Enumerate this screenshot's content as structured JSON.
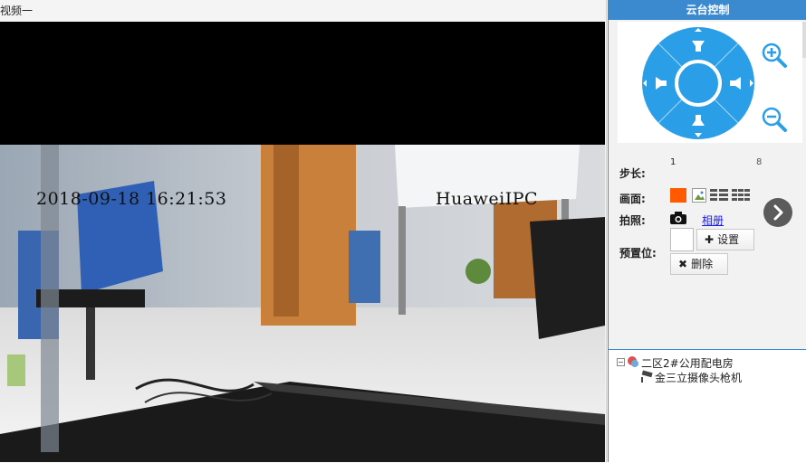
{
  "video": {
    "title": "视频一",
    "osd_time": "2018-09-18 16:21:53",
    "osd_brand": "HuaweiIPC"
  },
  "ptz": {
    "header": "云台控制",
    "step_label": "步长:",
    "step_min": "1",
    "step_max": "8",
    "screen_label": "画面:",
    "snapshot_label": "拍照:",
    "album_link": "相册",
    "preset_label": "预置位:",
    "set_button": "设置",
    "delete_button": "删除",
    "accent_color": "#2b9ee8",
    "header_color": "#3b8ad0"
  },
  "tree": {
    "toggle": "−",
    "root_label": "二区2#公用配电房",
    "child_label": "金三立摄像头枪机"
  }
}
